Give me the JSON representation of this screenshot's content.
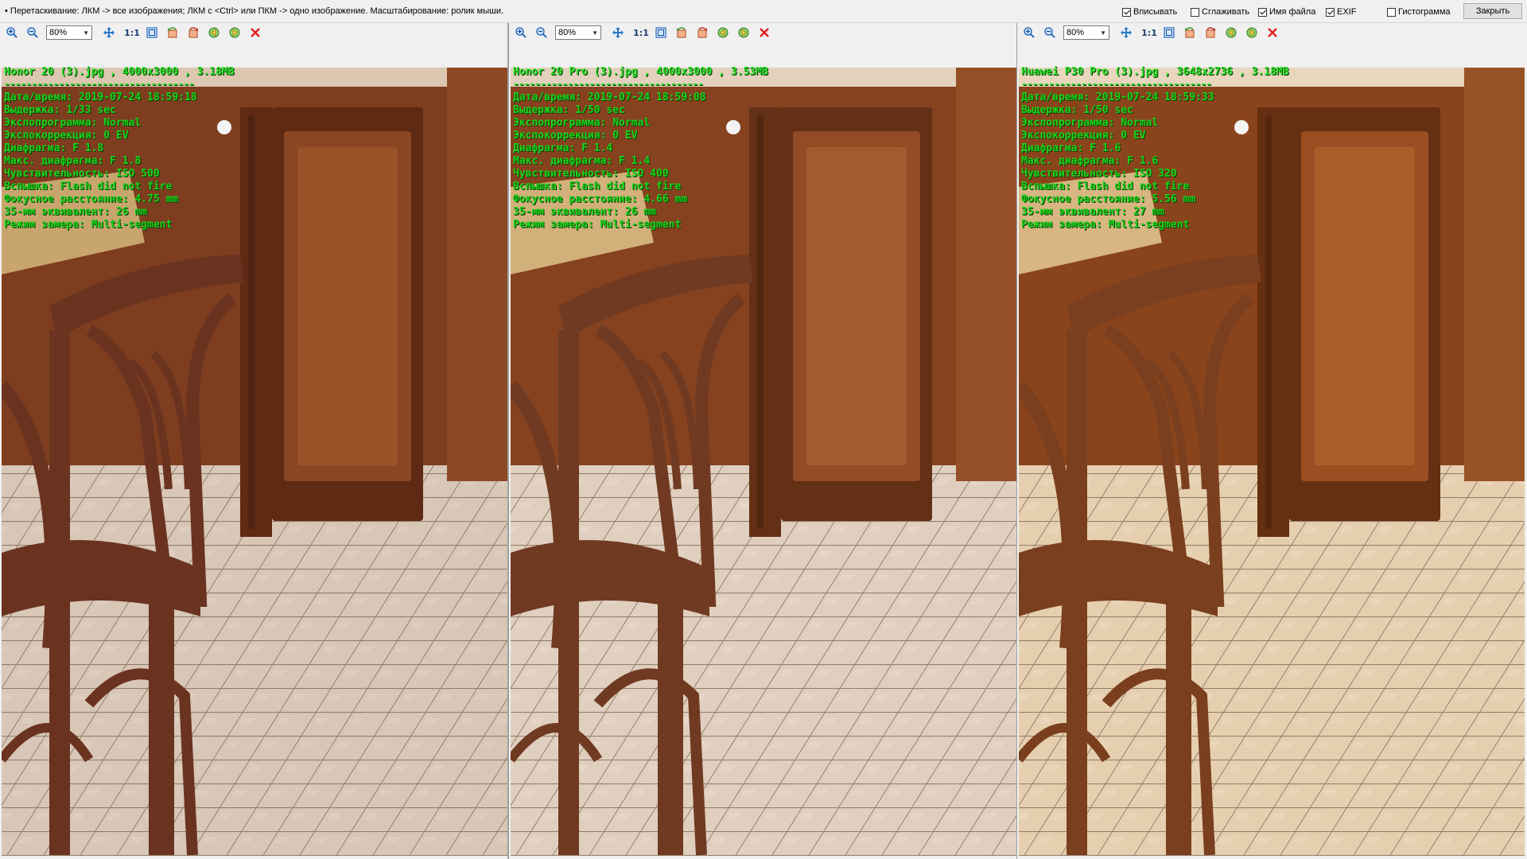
{
  "hint": "• Перетаскивание: ЛКМ -> все изображения; ЛКМ с <Ctrl> или ПКМ -> одно изображение. Масштабирование: ролик мыши.",
  "options": [
    {
      "label": "Вписывать",
      "checked": true
    },
    {
      "label": "Сглаживать",
      "checked": false
    },
    {
      "label": "Имя файла",
      "checked": true
    },
    {
      "label": "EXIF",
      "checked": true
    },
    {
      "label": "Гистограмма",
      "checked": false
    }
  ],
  "close_label": "Закрыть",
  "toolbar": {
    "zoom_value": "80%",
    "one_to_one": "1:1",
    "icons": [
      "zoom-in-icon",
      "zoom-out-icon",
      "fit-icon",
      "actual-size-icon",
      "fullscreen-icon",
      "rotate-left-icon",
      "rotate-right-icon",
      "prev-image-icon",
      "next-image-icon",
      "close-pane-icon"
    ]
  },
  "panes": [
    {
      "file_line": "Honor 20 (3).jpg , 4000x3000 , 3.18MB",
      "dashes": "-----------------------------------",
      "exif": [
        "Дата/время: 2019-07-24 18:59:18",
        "Выдержка: 1/33 sec",
        "Экспопрограмма: Normal",
        "Экспокоррекция: 0 EV",
        "Диафрагма: F 1.8",
        "Макс. диафрагма: F 1.8",
        "Чувствительность: ISO 500",
        "Вспышка: Flash did not fire",
        "Фокусное расстояние: 4.75 mm",
        "35-мм эквивалент: 26 mm",
        "Режим замера: Multi-segment"
      ]
    },
    {
      "file_line": "Honor 20 Pro (3).jpg , 4000x3000 , 3.53MB",
      "dashes": "-----------------------------------",
      "exif": [
        "Дата/время: 2019-07-24 18:59:08",
        "Выдержка: 1/50 sec",
        "Экспопрограмма: Normal",
        "Экспокоррекция: 0 EV",
        "Диафрагма: F 1.4",
        "Макс. диафрагма: F 1.4",
        "Чувствительность: ISO 400",
        "Вспышка: Flash did not fire",
        "Фокусное расстояние: 4.66 mm",
        "35-мм эквивалент: 26 mm",
        "Режим замера: Multi-segment"
      ]
    },
    {
      "file_line": "Huawei P30 Pro (3).jpg , 3648x2736 , 3.18MB",
      "dashes": "-----------------------------------",
      "exif": [
        "Дата/время: 2019-07-24 18:59:33",
        "Выдержка: 1/50 sec",
        "Экспопрограмма: Normal",
        "Экспокоррекция: 0 EV",
        "Диафрагма: F 1.6",
        "Макс. диафрагма: F 1.6",
        "Чувствительность: ISO 320",
        "Вспышка: Flash did not fire",
        "Фокусное расстояние: 5.56 mm",
        "35-мм эквивалент: 27 mm",
        "Режим замера: Multi-segment"
      ]
    }
  ],
  "colors": {
    "exif_text": "#18d418",
    "cabinet": "#7a3b1e",
    "chair": "#6b3520",
    "floor": "#d9c4b0"
  }
}
